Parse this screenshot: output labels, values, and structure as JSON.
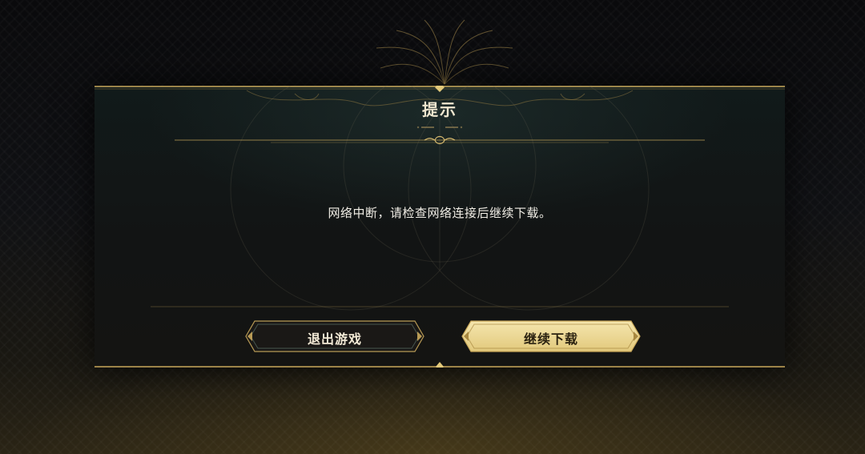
{
  "dialog": {
    "title": "提示",
    "message": "网络中断，请检查网络连接后继续下载。"
  },
  "buttons": {
    "exit_label": "退出游戏",
    "continue_label": "继续下载"
  },
  "colors": {
    "gold": "#c9a85a",
    "gold_light": "#e8d595",
    "button_dark": "#1a1816",
    "button_gold": "#efdb98",
    "text_light": "#f1eee6"
  },
  "icons": [
    "ornament-top-crest",
    "ornament-title-flourish",
    "ornament-bottom-diamond"
  ]
}
